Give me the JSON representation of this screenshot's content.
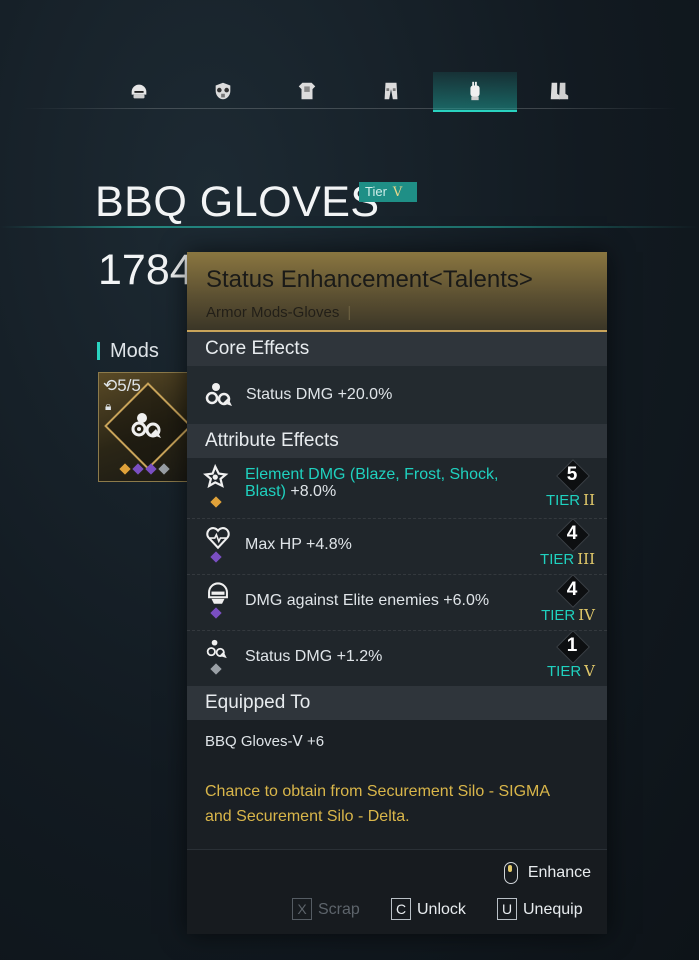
{
  "tabs": [
    {
      "icon": "helmet-icon",
      "active": false
    },
    {
      "icon": "mask-icon",
      "active": false
    },
    {
      "icon": "top-armor-icon",
      "active": false
    },
    {
      "icon": "pants-icon",
      "active": false
    },
    {
      "icon": "gloves-icon",
      "active": true
    },
    {
      "icon": "boots-icon",
      "active": false
    }
  ],
  "item": {
    "name": "BBQ GLOVES",
    "tier_label": "Tier",
    "tier_numeral": "V",
    "score": "1784"
  },
  "mods": {
    "label": "Mods",
    "slot_count": "5/5"
  },
  "tooltip": {
    "name": "Status Enhancement<Talents>",
    "category": "Armor Mods-Gloves",
    "core_header": "Core Effects",
    "core_effect": "Status DMG +20.0%",
    "attr_header": "Attribute Effects",
    "attributes": [
      {
        "label_highlight": "Element DMG (Blaze, Frost, Shock, Blast)",
        "label_rest": " +8.0%",
        "level": "5",
        "tier_word": "TIER",
        "tier_numeral": "II",
        "dot_color": "#e0a23a",
        "icon": "element-icon"
      },
      {
        "label": "Max HP +4.8%",
        "level": "4",
        "tier_word": "TIER",
        "tier_numeral": "III",
        "dot_color": "#7a4fc2",
        "icon": "heart-icon"
      },
      {
        "label": "DMG against Elite enemies +6.0%",
        "level": "4",
        "tier_word": "TIER",
        "tier_numeral": "IV",
        "dot_color": "#7a4fc2",
        "icon": "elite-icon"
      },
      {
        "label": "Status DMG +1.2%",
        "level": "1",
        "tier_word": "TIER",
        "tier_numeral": "V",
        "dot_color": "#9aa0a6",
        "icon": "status-icon"
      }
    ],
    "equipped_header": "Equipped To",
    "equipped_to": "BBQ Gloves-Ⅴ +6",
    "source_line1": "Chance to obtain from Securement Silo - SIGMA",
    "source_line2": "and Securement Silo - Delta.",
    "actions": {
      "enhance": "Enhance",
      "scrap_key": "X",
      "scrap": "Scrap",
      "unlock_key": "C",
      "unlock": "Unlock",
      "unequip_key": "U",
      "unequip": "Unequip"
    }
  },
  "colors": {
    "accent_teal": "#2ad3c0",
    "gold": "#e2c96a",
    "source_text": "#d9b64a"
  }
}
